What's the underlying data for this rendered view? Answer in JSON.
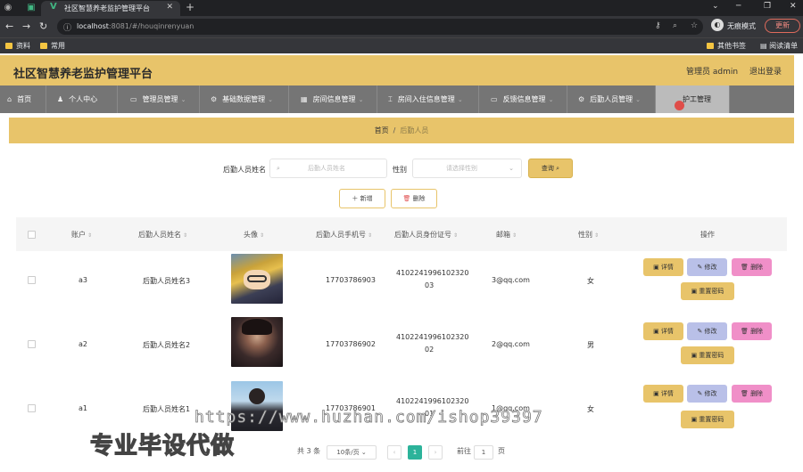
{
  "browser": {
    "tab_title": "社区智慧养老监护管理平台",
    "url_host": "localhost",
    "url_rest": ":8081/#/houqinrenyuan",
    "profile_label": "无痕模式",
    "update_label": "更新",
    "bookmarks": [
      "资料",
      "常用"
    ],
    "bookmarks_right": [
      "其他书签",
      "阅读清单"
    ]
  },
  "header": {
    "title": "社区智慧养老监护管理平台",
    "user": "管理员 admin",
    "logout": "退出登录"
  },
  "nav": {
    "items": [
      {
        "label": "首页",
        "icon": "home-icon",
        "chev": false
      },
      {
        "label": "个人中心",
        "icon": "user-icon",
        "chev": false
      },
      {
        "label": "管理员管理",
        "icon": "admin-icon",
        "chev": true
      },
      {
        "label": "基础数据管理",
        "icon": "data-icon",
        "chev": true
      },
      {
        "label": "房间信息管理",
        "icon": "room-icon",
        "chev": true
      },
      {
        "label": "房间入住信息管理",
        "icon": "checkin-icon",
        "chev": true
      },
      {
        "label": "反馈信息管理",
        "icon": "feedback-icon",
        "chev": true
      },
      {
        "label": "后勤人员管理",
        "icon": "logistics-icon",
        "chev": true
      },
      {
        "label": "护工管理",
        "icon": "nurse-icon",
        "chev": false
      }
    ]
  },
  "breadcrumb": {
    "home": "首页",
    "sep": "/",
    "current": "后勤人员"
  },
  "search": {
    "name_label": "后勤人员姓名",
    "name_placeholder": "后勤人员姓名",
    "gender_label": "性别",
    "gender_placeholder": "请选择性别",
    "query_label": "查询"
  },
  "actions": {
    "add_label": "新增",
    "delete_label": "删除"
  },
  "table": {
    "headers": [
      "账户",
      "后勤人员姓名",
      "头像",
      "后勤人员手机号",
      "后勤人员身份证号",
      "邮箱",
      "性别",
      "操作"
    ],
    "rows": [
      {
        "account": "a3",
        "name": "后勤人员姓名3",
        "phone": "17703786903",
        "id_line1": "4102241996102320",
        "id_line2": "03",
        "email": "3@qq.com",
        "gender": "女"
      },
      {
        "account": "a2",
        "name": "后勤人员姓名2",
        "phone": "17703786902",
        "id_line1": "4102241996102320",
        "id_line2": "02",
        "email": "2@qq.com",
        "gender": "男"
      },
      {
        "account": "a1",
        "name": "后勤人员姓名1",
        "phone": "17703786901",
        "id_line1": "4102241996102320",
        "id_line2": "01",
        "email": "1@qq.com",
        "gender": "女"
      }
    ],
    "row_buttons": {
      "detail": "详情",
      "edit": "修改",
      "delete": "删除",
      "reset": "重置密码"
    }
  },
  "pagination": {
    "total": "共 3 条",
    "page_size": "10条/页",
    "current_page": "1",
    "goto_label": "前往",
    "goto_value": "1",
    "page_unit": "页"
  },
  "watermark": {
    "url": "https://www.huzhan.com/ishop39397",
    "text": "专业毕设代做"
  },
  "colors": {
    "accent": "#e8c46a",
    "nav": "#757575",
    "edit": "#b9c0e8",
    "delete": "#f08fc8"
  }
}
